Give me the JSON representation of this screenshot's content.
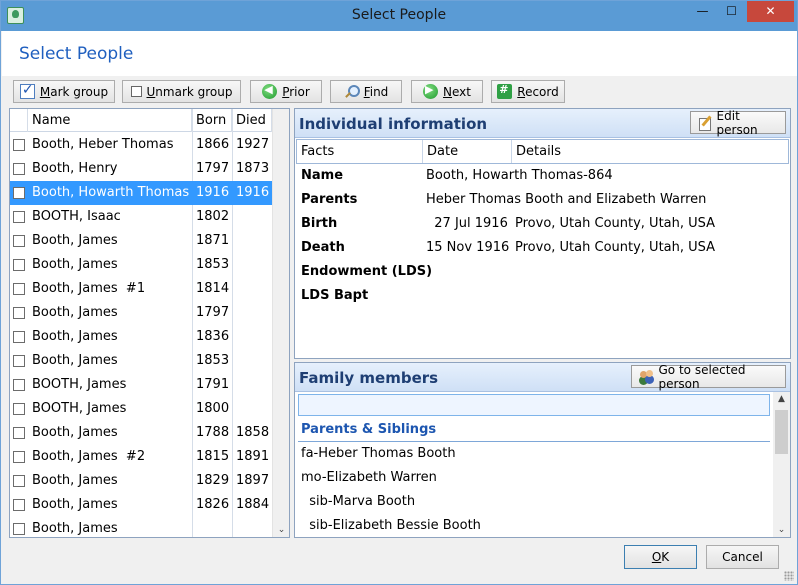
{
  "window": {
    "title": "Select People",
    "minimize_glyph": "—",
    "maximize_glyph": "☐",
    "close_glyph": "✕",
    "accent": "#5a9bd5",
    "close_color": "#c7483c"
  },
  "header": {
    "title": "Select People",
    "title_color": "#1f5fbf"
  },
  "toolbar": {
    "mark_group": {
      "prefix": "M",
      "rest": "ark group",
      "icon": "checkbox-checked-icon"
    },
    "unmark_group": {
      "prefix": "U",
      "rest": "nmark group",
      "icon": "checkbox-empty-icon"
    },
    "prior": {
      "prefix": "P",
      "rest": "rior",
      "icon": "arrow-left-icon",
      "glyph": "◀"
    },
    "find": {
      "prefix": "F",
      "rest": "ind",
      "icon": "magnifier-icon"
    },
    "next": {
      "prefix": "N",
      "rest": "ext",
      "icon": "arrow-right-icon",
      "glyph": "▶"
    },
    "record": {
      "prefix": "R",
      "rest": "ecord",
      "icon": "record-icon",
      "glyph": "#"
    }
  },
  "people_list": {
    "columns": {
      "name": "Name",
      "born": "Born",
      "died": "Died"
    },
    "selection_color": "#3399ff",
    "rows": [
      {
        "name": "Booth, Heber Thomas",
        "born": "1866",
        "died": "1927",
        "selected": false
      },
      {
        "name": "Booth, Henry",
        "born": "1797",
        "died": "1873",
        "selected": false
      },
      {
        "name": "Booth, Howarth Thomas",
        "born": "1916",
        "died": "1916",
        "selected": true
      },
      {
        "name": "BOOTH, Isaac",
        "born": "1802",
        "died": "",
        "selected": false
      },
      {
        "name": "Booth, James",
        "born": "1871",
        "died": "",
        "selected": false
      },
      {
        "name": "Booth, James",
        "born": "1853",
        "died": "",
        "selected": false
      },
      {
        "name": "Booth, James  #1",
        "born": "1814",
        "died": "",
        "selected": false
      },
      {
        "name": "Booth, James",
        "born": "1797",
        "died": "",
        "selected": false
      },
      {
        "name": "Booth, James",
        "born": "1836",
        "died": "",
        "selected": false
      },
      {
        "name": "Booth, James",
        "born": "1853",
        "died": "",
        "selected": false
      },
      {
        "name": "BOOTH, James",
        "born": "1791",
        "died": "",
        "selected": false
      },
      {
        "name": "BOOTH, James",
        "born": "1800",
        "died": "",
        "selected": false
      },
      {
        "name": "Booth, James",
        "born": "1788",
        "died": "1858",
        "selected": false
      },
      {
        "name": "Booth, James  #2",
        "born": "1815",
        "died": "1891",
        "selected": false
      },
      {
        "name": "Booth, James",
        "born": "1829",
        "died": "1897",
        "selected": false
      },
      {
        "name": "Booth, James",
        "born": "1826",
        "died": "1884",
        "selected": false
      },
      {
        "name": "Booth, James",
        "born": "",
        "died": "",
        "selected": false
      }
    ],
    "scroll_down_glyph": "⌄"
  },
  "individual": {
    "title": "Individual information",
    "edit_button": "Edit person",
    "columns": {
      "facts": "Facts",
      "date": "Date",
      "details": "Details"
    },
    "facts": [
      {
        "fact": "Name",
        "date": "Booth, Howarth Thomas-864",
        "details": ""
      },
      {
        "fact": "Parents",
        "date": "Heber Thomas Booth and Elizabeth Warren",
        "details": ""
      },
      {
        "fact": "Birth",
        "date": "  27 Jul 1916",
        "details": "Provo, Utah County, Utah, USA"
      },
      {
        "fact": "Death",
        "date": "15 Nov 1916",
        "details": "Provo, Utah County, Utah, USA"
      },
      {
        "fact": "Endowment (LDS)",
        "date": "",
        "details": ""
      },
      {
        "fact": "LDS Bapt",
        "date": "",
        "details": ""
      }
    ]
  },
  "family": {
    "title": "Family members",
    "goto_button": "Go to selected person",
    "section": "Parents & Siblings",
    "members": [
      "fa-Heber Thomas Booth",
      "mo-Elizabeth Warren",
      "  sib-Marva Booth",
      "  sib-Elizabeth Bessie Booth"
    ],
    "scroll_up_glyph": "▲",
    "scroll_down_glyph": "⌄"
  },
  "footer": {
    "ok": {
      "prefix": "O",
      "rest": "K"
    },
    "cancel": "Cancel"
  }
}
